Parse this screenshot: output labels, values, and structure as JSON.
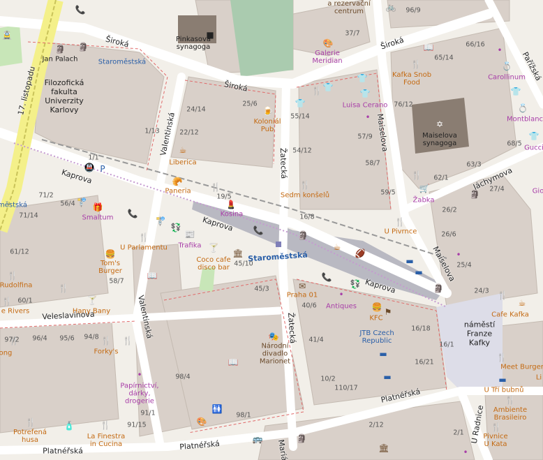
{
  "colors": {
    "background": "#f2efe9",
    "building": "#d9d0c9",
    "road": "#ffffff",
    "road_casing": "#c8c0b8",
    "pedestrian": "#dddde8",
    "rail": "#999999",
    "grass": "#c8e6b8",
    "cemetery": "#aacbaf",
    "poi_food": "#c46a12",
    "poi_shop": "#a83ea8",
    "transit": "#2a5fa8"
  },
  "streets": [
    {
      "id": "sirokaw",
      "name": "Široká"
    },
    {
      "id": "sirokam",
      "name": "Široká"
    },
    {
      "id": "sirokae",
      "name": "Široká"
    },
    {
      "id": "kaprovaw",
      "name": "Kaprova"
    },
    {
      "id": "kaprovam",
      "name": "Kaprova"
    },
    {
      "id": "kaprovae",
      "name": "Kaprova"
    },
    {
      "id": "valent1",
      "name": "Valentinská"
    },
    {
      "id": "valent2",
      "name": "Valentinská"
    },
    {
      "id": "zatecka1",
      "name": "Žatecká"
    },
    {
      "id": "zatecka2",
      "name": "Žatecká"
    },
    {
      "id": "maiselova1",
      "name": "Maiselova"
    },
    {
      "id": "maiselova2",
      "name": "Maiselova"
    },
    {
      "id": "jachymova",
      "name": "Jáchymova"
    },
    {
      "id": "parizska",
      "name": "Pařížská"
    },
    {
      "id": "veleslav",
      "name": "Veleslavínova"
    },
    {
      "id": "platn1",
      "name": "Platnéřská"
    },
    {
      "id": "platn2",
      "name": "Platnéřská"
    },
    {
      "id": "platn3",
      "name": "Platnéřská"
    },
    {
      "id": "listopadu",
      "name": "17. listopadu"
    },
    {
      "id": "uradnice",
      "name": "U Radnice"
    },
    {
      "id": "maria",
      "name": "Mariá"
    }
  ],
  "places": {
    "square": [
      "náměstí",
      "Franze",
      "Kafky"
    ],
    "stop_main": "Staroměstská",
    "stop_nw": "Staroměstská",
    "stop_w": "městská",
    "pinkas": [
      "Pinkasova",
      "synagoga"
    ],
    "maisel": [
      "Maiselova",
      "synagoga"
    ],
    "faculty": [
      "Filozofická",
      "fakulta",
      "Univerzity",
      "Karlovy"
    ]
  },
  "pois": [
    {
      "id": "janpalach",
      "text": "Jan Palach"
    },
    {
      "id": "galerie",
      "text": "Galerie\nMeridian"
    },
    {
      "id": "rezervacni",
      "text": "a rezervační\ncentrum"
    },
    {
      "id": "kafkasnob",
      "text": "Kafka Snob\nFood"
    },
    {
      "id": "carollinum",
      "text": "Carollinum"
    },
    {
      "id": "montblanc",
      "text": "Montblanc"
    },
    {
      "id": "gucci",
      "text": "Gucci"
    },
    {
      "id": "gio",
      "text": "Gio"
    },
    {
      "id": "luisa",
      "text": "Luisa Cerano"
    },
    {
      "id": "koloniak",
      "text": "Koloniál\nPub"
    },
    {
      "id": "liberica",
      "text": "Liberica"
    },
    {
      "id": "paneria",
      "text": "Paneria"
    },
    {
      "id": "kosina",
      "text": "Kosina"
    },
    {
      "id": "sedm",
      "text": "Sedm konšelů"
    },
    {
      "id": "pivrnce",
      "text": "U Pivrnce"
    },
    {
      "id": "zabka",
      "text": "Žabka"
    },
    {
      "id": "smaltum",
      "text": "Smaltum"
    },
    {
      "id": "parlamentu",
      "text": "U Parlamentu"
    },
    {
      "id": "trafika",
      "text": "Trafika"
    },
    {
      "id": "cococafe",
      "text": "Coco cafe\ndisco bar"
    },
    {
      "id": "toms",
      "text": "Tom's\nBurger"
    },
    {
      "id": "rudolfina",
      "text": "Rudolfina"
    },
    {
      "id": "hanybany",
      "text": "Hany Bany"
    },
    {
      "id": "rivers",
      "text": "e Rivers"
    },
    {
      "id": "praha01",
      "text": "Praha 01"
    },
    {
      "id": "antiques",
      "text": "Antiques"
    },
    {
      "id": "kfc",
      "text": "KFC"
    },
    {
      "id": "jtb",
      "text": "JTB Czech\nRepublic"
    },
    {
      "id": "cafekafka",
      "text": "Cafe Kafka"
    },
    {
      "id": "narodni",
      "text": "Národní\ndivadlo\nMarionet"
    },
    {
      "id": "forkys",
      "text": "Forky's"
    },
    {
      "id": "papirnictvi",
      "text": "Papírnictví,\ndárky,\ndrogerie"
    },
    {
      "id": "potrefena",
      "text": "Potrefená\nhusa"
    },
    {
      "id": "lafinestra",
      "text": "La Finestra\nin Cucina"
    },
    {
      "id": "meetburger",
      "text": "Meet Burger"
    },
    {
      "id": "utribubnu",
      "text": "U Tří bubnů"
    },
    {
      "id": "ambiente",
      "text": "Ambiente\nBrasileiro"
    },
    {
      "id": "pivnice",
      "text": "Pivnice\nU Kata"
    },
    {
      "id": "ong",
      "text": "ong"
    },
    {
      "id": "li",
      "text": "Li"
    }
  ],
  "house_numbers": [
    "96/9",
    "37/7",
    "66/16",
    "65/14",
    "76/12",
    "55/14",
    "57/9",
    "58/7",
    "54/12",
    "59/5",
    "62/1",
    "63/3",
    "68/5",
    "27/4",
    "26/2",
    "26/6",
    "25/4",
    "24/3",
    "24/14",
    "25/6",
    "22/12",
    "1/13",
    "1/1",
    "19/5",
    "16/8",
    "71/2",
    "56/4",
    "71/14",
    "61/12",
    "58/7",
    "60/1",
    "45/10",
    "45/3",
    "40/6",
    "41/4",
    "16/18",
    "16/1",
    "16/21",
    "10/2",
    "110/17",
    "97/2",
    "96/4",
    "95/6",
    "94/8",
    "98/4",
    "91/1",
    "91/15",
    "98/1",
    "2/12",
    "2/1"
  ]
}
